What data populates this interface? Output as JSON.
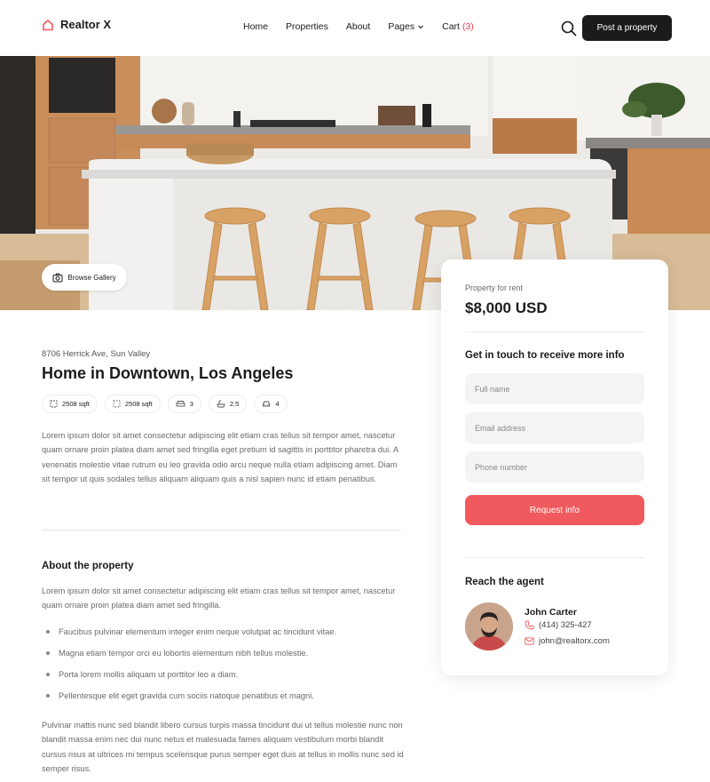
{
  "header": {
    "logo": "Realtor X",
    "nav": [
      {
        "label": "Home"
      },
      {
        "label": "Properties"
      },
      {
        "label": "About"
      },
      {
        "label": "Pages"
      },
      {
        "label": "Cart"
      }
    ],
    "cart_count": "(3)",
    "post_button": "Post a property"
  },
  "hero": {
    "gallery_button": "Browse Gallery"
  },
  "listing": {
    "address": "8706 Herrick Ave, Sun Valley",
    "title": "Home in Downtown, Los Angeles",
    "features": [
      {
        "icon": "area-icon",
        "value": "2508 sqft"
      },
      {
        "icon": "lot-icon",
        "value": "2508 sqft"
      },
      {
        "icon": "bed-icon",
        "value": "3"
      },
      {
        "icon": "bath-icon",
        "value": "2.5"
      },
      {
        "icon": "car-icon",
        "value": "4"
      }
    ],
    "description": "Lorem ipsum dolor sit amet consectetur adipiscing elit etiam cras tellus sit tempor amet, nascetur quam ornare proin platea diam amet sed fringilla eget pretium id sagittis in porttitor pharetra dui. A venenatis molestie vitae rutrum eu leo gravida odio arcu neque nulla etiam adipiscing amet. Diam sit tempor ut quis sodales tellus aliquam aliquam quis a nisl sapien nunc id etiam penatibus."
  },
  "about": {
    "title": "About the property",
    "intro": "Lorem ipsum dolor sit amet consectetur adipiscing elit etiam cras tellus sit tempor amet, nascetur quam ornare proin platea diam amet sed fringilla.",
    "bullets": [
      "Faucibus pulvinar elementum integer enim neque volutpat ac tincidunt vitae.",
      "Magna etiam tempor orci eu lobortis elementum nibh tellus molestie.",
      "Porta lorem mollis aliquam ut porttitor leo a diam.",
      "Pellentesque elit eget gravida cum sociis natoque penatibus et magni."
    ],
    "closing": "Pulvinar mattis nunc sed blandit libero cursus turpis massa tincidunt dui ut tellus molestie nunc non blandit massa enim nec dui nunc netus et malesuada fames aliquam vestibulum morbi blandit cursus risus at ultrices mi tempus scelerisque purus semper eget duis at tellus in mollis nunc sed id semper risus."
  },
  "card": {
    "rent_label": "Property for rent",
    "price": "$8,000 USD",
    "contact_title": "Get in touch to receive more info",
    "fields": {
      "name_placeholder": "Full name",
      "email_placeholder": "Email address",
      "phone_placeholder": "Phone number"
    },
    "request_button": "Request info",
    "agent_title": "Reach the agent",
    "agent": {
      "name": "John Carter",
      "phone": "(414) 325-427",
      "email": "john@realtorx.com"
    }
  },
  "colors": {
    "accent": "#f05a5e",
    "dark": "#1b1b1b",
    "muted_text": "#6a6a6a",
    "field_bg": "#f4f4f5"
  }
}
